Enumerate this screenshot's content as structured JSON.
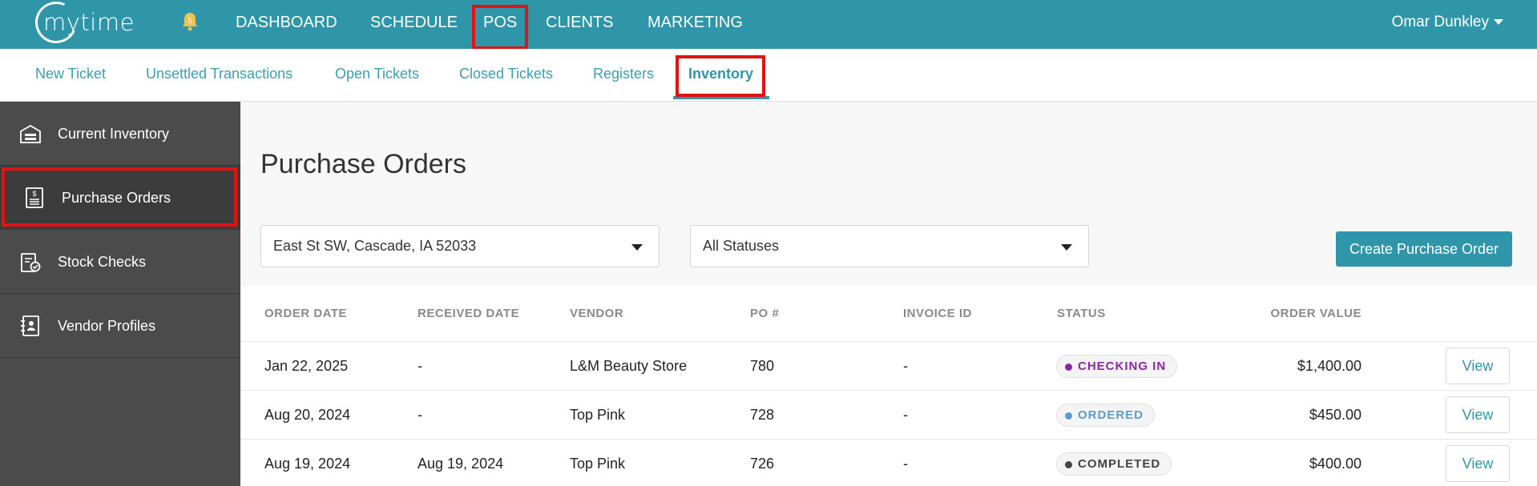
{
  "app": {
    "logo_text": "mytime",
    "notification_count": "5"
  },
  "topnav": {
    "items": [
      "DASHBOARD",
      "SCHEDULE",
      "POS",
      "CLIENTS",
      "MARKETING"
    ],
    "active": "POS",
    "user_name": "Omar Dunkley"
  },
  "subnav": {
    "items": [
      "New Ticket",
      "Unsettled Transactions",
      "Open Tickets",
      "Closed Tickets",
      "Registers",
      "Inventory"
    ],
    "active": "Inventory"
  },
  "sidebar": {
    "items": [
      {
        "label": "Current Inventory",
        "icon": "warehouse-icon"
      },
      {
        "label": "Purchase Orders",
        "icon": "invoice-icon"
      },
      {
        "label": "Stock Checks",
        "icon": "clipboard-check-icon"
      },
      {
        "label": "Vendor Profiles",
        "icon": "contact-book-icon"
      }
    ],
    "active": "Purchase Orders"
  },
  "main": {
    "title": "Purchase Orders",
    "location_select": "East St SW, Cascade, IA 52033",
    "status_select": "All Statuses",
    "create_button": "Create Purchase Order"
  },
  "table": {
    "headers": [
      "ORDER DATE",
      "RECEIVED DATE",
      "VENDOR",
      "PO #",
      "INVOICE ID",
      "STATUS",
      "ORDER VALUE"
    ],
    "rows": [
      {
        "order_date": "Jan 22, 2025",
        "received_date": "-",
        "vendor": "L&M Beauty Store",
        "po": "780",
        "invoice": "-",
        "status": "CHECKING IN",
        "status_color": "#8e24aa",
        "value": "$1,400.00",
        "action": "View"
      },
      {
        "order_date": "Aug 20, 2024",
        "received_date": "-",
        "vendor": "Top Pink",
        "po": "728",
        "invoice": "-",
        "status": "ORDERED",
        "status_color": "#5b9bd5",
        "value": "$450.00",
        "action": "View"
      },
      {
        "order_date": "Aug 19, 2024",
        "received_date": "Aug 19, 2024",
        "vendor": "Top Pink",
        "po": "726",
        "invoice": "-",
        "status": "COMPLETED",
        "status_color": "#444444",
        "value": "$400.00",
        "action": "View"
      }
    ]
  },
  "colors": {
    "brand": "#2f95a9",
    "highlight": "#e01212",
    "sidebar_bg": "#4b4b4b"
  }
}
